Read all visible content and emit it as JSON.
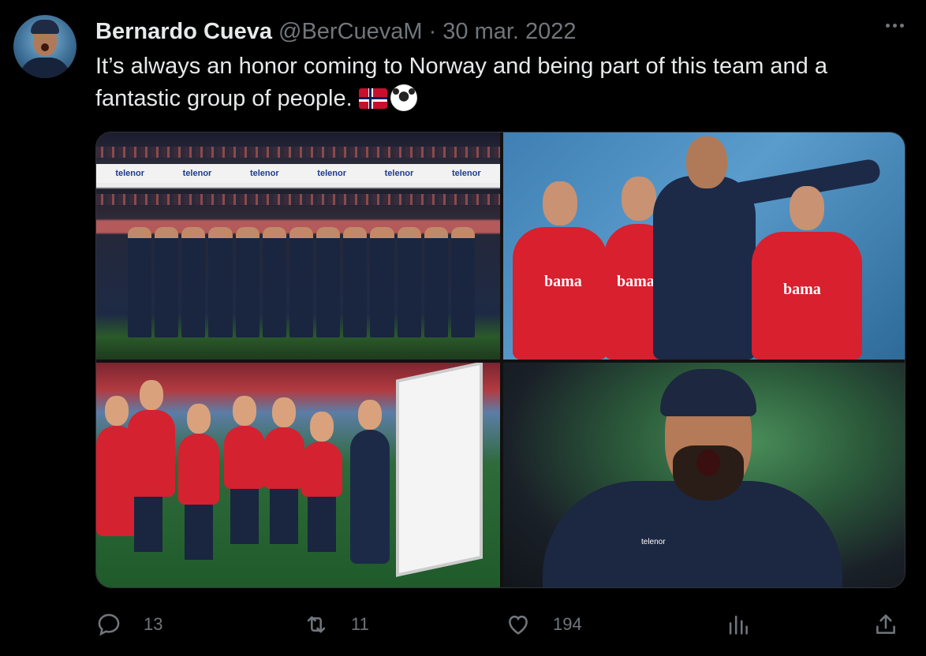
{
  "tweet": {
    "author_name": "Bernardo Cueva",
    "author_handle": "@BerCuevaM",
    "separator": "·",
    "date": "30 mar. 2022",
    "text": "It’s always an honor coming to Norway and being part of this team and a fantastic group of people.",
    "emojis": [
      "norway-flag",
      "soccer-ball"
    ]
  },
  "media": {
    "photo1": {
      "banner_word": "telenor"
    },
    "photo2": {
      "sponsor_word": "bama"
    },
    "photo4": {
      "jacket_brand": "telenor"
    }
  },
  "actions": {
    "reply_count": "13",
    "retweet_count": "11",
    "like_count": "194",
    "views_icon": "bar-chart-icon",
    "share_icon": "share-icon"
  },
  "colors": {
    "background": "#000000",
    "text_primary": "#e7e9ea",
    "text_secondary": "#71767b",
    "border": "#2f3336"
  }
}
